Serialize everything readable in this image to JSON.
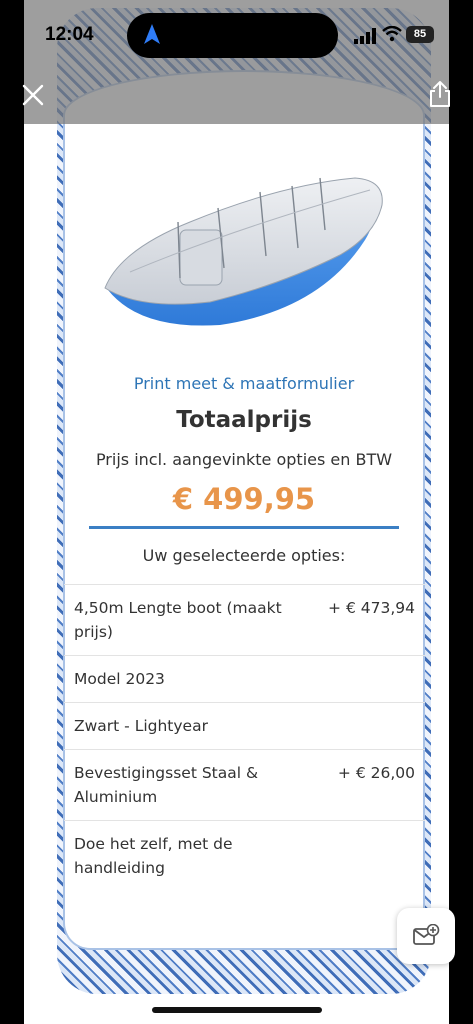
{
  "status_bar": {
    "time": "12:04",
    "battery": "85"
  },
  "product": {
    "form_link": "Print meet & maatformulier",
    "title": "Totaalprijs",
    "subtitle": "Prijs incl. aangevinkte opties en BTW",
    "price": "€ 499,95"
  },
  "options": {
    "heading": "Uw geselecteerde opties:",
    "items": [
      {
        "label": "4,50m Lengte boot (maakt prijs)",
        "price": "+ € 473,94"
      },
      {
        "label": "Model 2023",
        "price": ""
      },
      {
        "label": "Zwart - Lightyear",
        "price": ""
      },
      {
        "label": "Bevestigingsset Staal & Aluminium",
        "price": "+ € 26,00"
      },
      {
        "label": "Doe het zelf, met de handleiding",
        "price": ""
      }
    ]
  },
  "colors": {
    "accent_link": "#2e75b6",
    "price": "#e8954a",
    "underline": "#3b7fc4"
  },
  "icons": [
    "close-icon",
    "share-icon",
    "navigation-arrow-icon",
    "signal-icon",
    "wifi-icon",
    "battery-icon",
    "mail-plus-icon"
  ]
}
